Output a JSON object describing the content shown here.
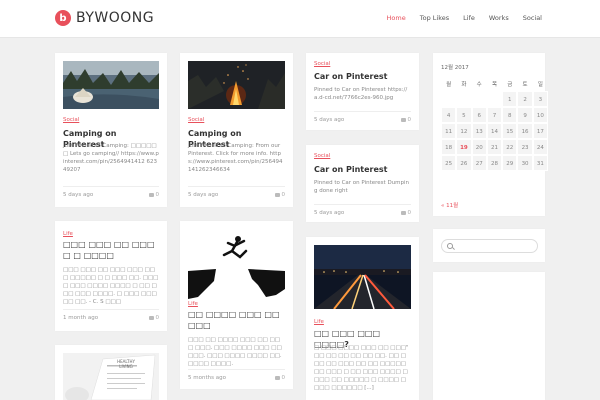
{
  "site": {
    "logo_letter": "b",
    "name": "BYWOONG"
  },
  "nav": [
    {
      "label": "Home",
      "active": true
    },
    {
      "label": "Top Likes"
    },
    {
      "label": "Life"
    },
    {
      "label": "Works"
    },
    {
      "label": "Social"
    }
  ],
  "posts": [
    {
      "category": "Social",
      "title": "Camping on Pinterest",
      "excerpt": "Just Pinned to Camping: □□□□□□ Lets go camping// https://www.pinterest.com/pin/2564941412 62349207",
      "date": "5 days ago",
      "comments": "0"
    },
    {
      "category": "Social",
      "title": "Camping on Pinterest",
      "excerpt": "Just Pinned to Camping: From our Pinterest. Click for more info. https://www.pinterest.com/pin/256494141262346634",
      "date": "5 days ago",
      "comments": "0"
    },
    {
      "category": "Social",
      "title": "Car on Pinterest",
      "excerpt": "Pinned to Car on Pinterest https://a.d-cd.net/7766c2es-960.jpg",
      "date": "5 days ago",
      "comments": "0"
    },
    {
      "category": "Social",
      "title": "Car on Pinterest",
      "excerpt": "Pinned to Car on Pinterest Dumping done right",
      "date": "5 days ago",
      "comments": "0"
    },
    {
      "category": "Life",
      "title": "□□□ □□□ □□ □□□ □ □ □□□□",
      "excerpt": "□□□ □□□ □□ □□□ □□□ □□□ □□□□□ □ □ □□□ □□. □□□□ □□□ □□□□ □□□□ □ □□ □□□ □□□ □□□□. □ □□□ □□□ □□ □□. - C. S □□□",
      "date": "1 month ago",
      "comments": "0"
    },
    {
      "category": "Life",
      "title": "□□ □□□□ □□□ □□ □□□",
      "excerpt": "□□□ □□ □□□□ □□□ □□ □□□ □□□. □□□ □□□□ □□□ □□ □□□. □□□ □□□□ □□□□ □□. □□□□ □□□□.",
      "date": "5 months ago",
      "comments": "0"
    },
    {
      "category": "Life",
      "title": "□□ □□□ □□□ □□□□?",
      "excerpt": "□ □□□ □□□□ □□□ □□ □□□\" □□ □□ □□ □□ □□ □□. □□ □□□ □□ □□□ □□ □□ □□□□□ □□ □□□ □ □□ □□□ □□□□ □□□□ □□ □□□□□ □ □□□□ □□□□ □□□□□□ [...]",
      "date": "",
      "comments": ""
    }
  ],
  "calendar": {
    "title": "12월 2017",
    "weekdays": [
      "월",
      "화",
      "수",
      "목",
      "금",
      "토",
      "일"
    ],
    "days": [
      "",
      "",
      "",
      "",
      "1",
      "2",
      "3",
      "4",
      "5",
      "6",
      "7",
      "8",
      "9",
      "10",
      "11",
      "12",
      "13",
      "14",
      "15",
      "16",
      "17",
      "18",
      "19",
      "20",
      "21",
      "22",
      "23",
      "24",
      "25",
      "26",
      "27",
      "28",
      "29",
      "30",
      "31"
    ],
    "today": "19",
    "prev_label": "« 11월"
  },
  "search": {
    "placeholder": ""
  },
  "receipt_text": "HEALTHY LIVING"
}
